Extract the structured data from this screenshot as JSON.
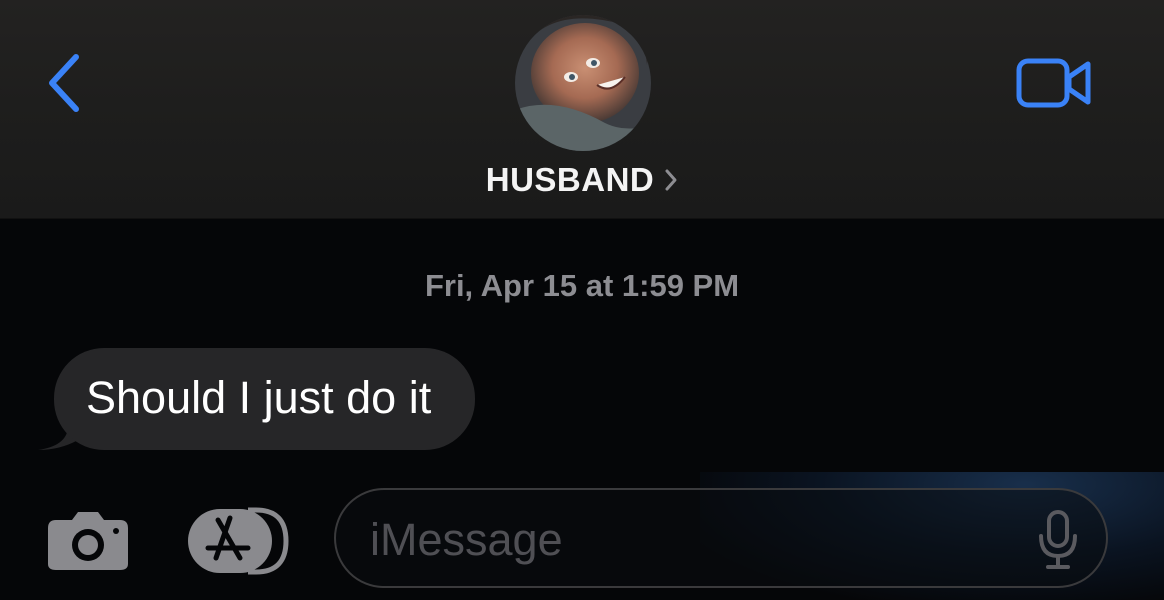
{
  "header": {
    "contact_name": "HUSBAND",
    "back_icon": "chevron-left-icon",
    "video_icon": "video-camera-icon",
    "disclosure_icon": "chevron-right-icon",
    "accent_color": "#3a82f7"
  },
  "conversation": {
    "timestamp": "Fri, Apr 15 at 1:59 PM",
    "messages": [
      {
        "direction": "incoming",
        "text": "Should I just do it"
      }
    ]
  },
  "composer": {
    "camera_icon": "camera-icon",
    "apps_icon": "app-store-icon",
    "mic_icon": "microphone-icon",
    "placeholder": "iMessage"
  }
}
